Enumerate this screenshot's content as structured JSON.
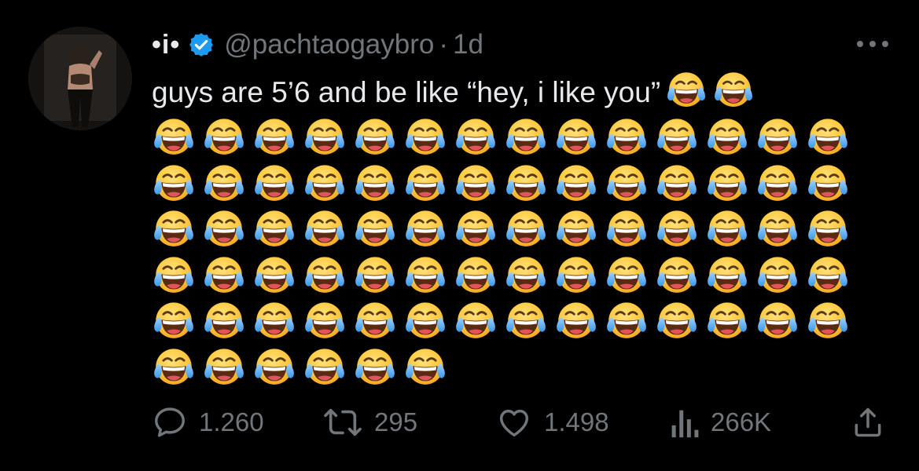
{
  "tweet": {
    "display_name": "•i•",
    "handle": "@pachtaogaybro",
    "separator": "·",
    "time": "1d",
    "text": "guys are 5’6 and be like “hey, i like you”",
    "verified": true,
    "emoji_name": "face-with-tears-of-joy",
    "inline_emoji_count": 2,
    "emoji_grid_rows": [
      14,
      14,
      14,
      14,
      14,
      6
    ]
  },
  "actions": {
    "replies": "1.260",
    "retweets": "295",
    "likes": "1.498",
    "views": "266K"
  },
  "colors": {
    "background": "#000000",
    "text": "#e7e9ea",
    "muted": "#71767b",
    "verified": "#1d9bf0"
  },
  "icons": {
    "reply": "reply-icon",
    "retweet": "retweet-icon",
    "like": "heart-icon",
    "views": "views-icon",
    "share": "share-icon",
    "more": "more-icon",
    "verified": "verified-badge-icon"
  }
}
